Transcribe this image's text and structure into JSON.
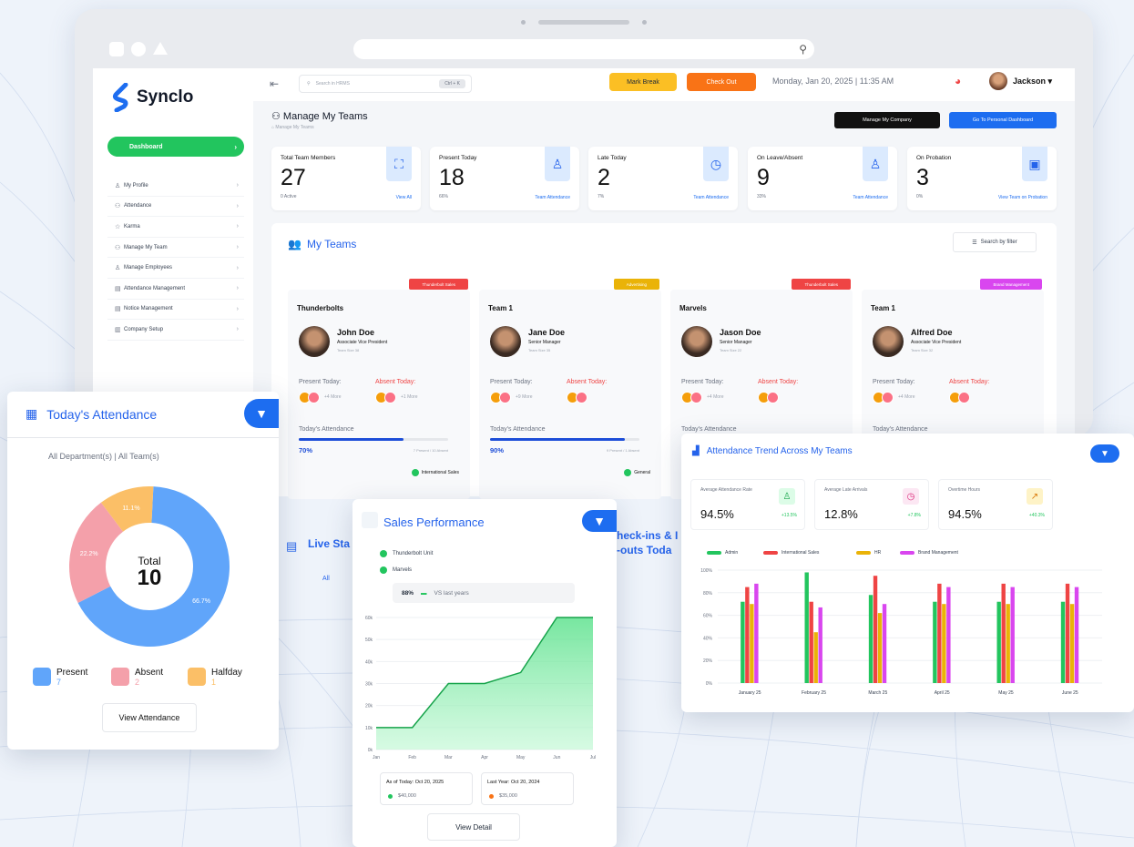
{
  "browser": {},
  "brand": {
    "name": "Synclo"
  },
  "sidebar": {
    "dashboard": "Dashboard",
    "items": [
      {
        "label": "My Profile",
        "icon": "user-icon"
      },
      {
        "label": "Attendance",
        "icon": "people-icon"
      },
      {
        "label": "Karma",
        "icon": "star-icon"
      },
      {
        "label": "Manage My Team",
        "icon": "team-icon"
      },
      {
        "label": "Manage Employees",
        "icon": "employee-icon"
      },
      {
        "label": "Attendance Management",
        "icon": "calendar-icon"
      },
      {
        "label": "Notice Management",
        "icon": "notice-icon"
      },
      {
        "label": "Company Setup",
        "icon": "building-icon"
      }
    ]
  },
  "topnav": {
    "search_placeholder": "Search in HRMS",
    "search_kbd": "Ctrl + K",
    "mark_break": "Mark Break",
    "check_out": "Check Out",
    "datetime": "Monday, Jan 20, 2025  |  11:35 AM",
    "user": "Jackson"
  },
  "page": {
    "title": "Manage My Teams",
    "breadcrumb": "Manage My Teams",
    "btn_company": "Manage My Company",
    "btn_personal": "Go To Personal Dashboard"
  },
  "stats": [
    {
      "label": "Total Team Members",
      "value": "27",
      "sub": "0 Active",
      "link": "View All",
      "icon": "team-icon"
    },
    {
      "label": "Present Today",
      "value": "18",
      "sub": "66%",
      "link": "Team Attendance",
      "icon": "user-check-icon"
    },
    {
      "label": "Late Today",
      "value": "2",
      "sub": "7%",
      "link": "Team Attendance",
      "icon": "clock-icon"
    },
    {
      "label": "On Leave/Absent",
      "value": "9",
      "sub": "33%",
      "link": "Team Attendance",
      "icon": "user-x-icon"
    },
    {
      "label": "On Probation",
      "value": "3",
      "sub": "0%",
      "link": "View Team on Probation",
      "icon": "badge-icon"
    }
  ],
  "teams": {
    "title": "My Teams",
    "search_filter": "Search by filter",
    "cards": [
      {
        "name": "Thunderbolts",
        "tag": "Thunderbolt Sales",
        "tag_color": "#ef4444",
        "person": "John Doe",
        "role": "Associate Vice President",
        "team": "Team Size 38",
        "present": "Present Today:",
        "absent": "Absent Today:",
        "present_more": "+4 More",
        "absent_more": "+1 More",
        "att_label": "Today's Attendance",
        "pct": "70%",
        "pct_value": 70,
        "counts": "7 Present / 10 Absent",
        "dept": "International Sales"
      },
      {
        "name": "Team 1",
        "tag": "Advertising",
        "tag_color": "#eab308",
        "person": "Jane Doe",
        "role": "Senior Manager",
        "team": "Team Size 35",
        "present": "Present Today:",
        "absent": "Absent Today:",
        "present_more": "+9 More",
        "absent_more": "",
        "att_label": "Today's Attendance",
        "pct": "90%",
        "pct_value": 90,
        "counts": "9 Present / 1 Absent",
        "dept": "General"
      },
      {
        "name": "Marvels",
        "tag": "Thunderbolt Sales",
        "tag_color": "#ef4444",
        "person": "Jason Doe",
        "role": "Senior Manager",
        "team": "Team Size 22",
        "present": "Present Today:",
        "absent": "Absent Today:",
        "present_more": "+4 More",
        "absent_more": "",
        "att_label": "Today's Attendance",
        "pct": "",
        "pct_value": 40,
        "counts": "",
        "dept": ""
      },
      {
        "name": "Team 1",
        "tag": "Brand Management",
        "tag_color": "#d946ef",
        "person": "Alfred Doe",
        "role": "Associate Vice President",
        "team": "Team Size 32",
        "present": "Present Today:",
        "absent": "Absent Today:",
        "present_more": "+4 More",
        "absent_more": "",
        "att_label": "Today's Attendance",
        "pct": "",
        "pct_value": 60,
        "counts": "",
        "dept": ""
      }
    ]
  },
  "attendance_card": {
    "title": "Today's Attendance",
    "filters": "All Department(s)   |   All Team(s)",
    "total_label": "Total",
    "total_value": "10",
    "slices": [
      {
        "label": "Present",
        "value": "7",
        "pct_label": "66.7%",
        "pct": 66.7,
        "color": "#60a5fa"
      },
      {
        "label": "Absent",
        "value": "2",
        "pct_label": "22.2%",
        "pct": 22.2,
        "color": "#f4a0aa"
      },
      {
        "label": "Halfday",
        "value": "1",
        "pct_label": "11.1%",
        "pct": 11.1,
        "color": "#fbbf67"
      }
    ],
    "view_btn": "View Attendance"
  },
  "sales_card": {
    "title": "Sales Performance",
    "legend": [
      "Thunderbolt Unit",
      "Marvels"
    ],
    "compare_pct": "88%",
    "compare_text": "VS last years",
    "box1_title": "As of Today: Oct 20, 2025",
    "box1_value": "$40,000",
    "box2_title": "Last Year: Oct 20, 2024",
    "box2_value": "$35,000",
    "view_btn": "View Detail"
  },
  "chart_data": [
    {
      "type": "area",
      "x": [
        "Jan",
        "Feb",
        "Mar",
        "Apr",
        "May",
        "Jun",
        "Jul"
      ],
      "series": [
        {
          "name": "Thunderbolt Unit",
          "values": [
            10,
            10,
            30,
            30,
            35,
            60,
            60
          ]
        }
      ],
      "yticks": [
        "0k",
        "10k",
        "20k",
        "30k",
        "40k",
        "50k",
        "60k"
      ],
      "ylim": [
        0,
        60
      ]
    },
    {
      "type": "bar",
      "title": "Attendance Trend Across My Teams",
      "categories": [
        "January 25",
        "February 25",
        "March 25",
        "April 25",
        "May 25",
        "June 25"
      ],
      "series": [
        {
          "name": "Admin",
          "color": "#22c55e",
          "values": [
            72,
            98,
            78,
            72,
            72,
            72
          ]
        },
        {
          "name": "International Sales",
          "color": "#ef4444",
          "values": [
            85,
            72,
            95,
            88,
            88,
            88
          ]
        },
        {
          "name": "HR",
          "color": "#eab308",
          "values": [
            70,
            45,
            62,
            70,
            70,
            70
          ]
        },
        {
          "name": "Brand Management",
          "color": "#d946ef",
          "values": [
            88,
            67,
            70,
            85,
            85,
            85
          ]
        }
      ],
      "yticks": [
        "0%",
        "20%",
        "40%",
        "60%",
        "80%",
        "100%"
      ],
      "ylim": [
        0,
        100
      ]
    }
  ],
  "trend_card": {
    "metrics": [
      {
        "label": "Average Attendance Rate",
        "value": "94.5%",
        "change": "+13.5%",
        "icon": "user-icon",
        "bg": "#dcfce7",
        "fg": "#16a34a"
      },
      {
        "label": "Average Late Arrivals",
        "value": "12.8%",
        "change": "+7.8%",
        "icon": "clock-icon",
        "bg": "#fce7f3",
        "fg": "#db2777"
      },
      {
        "label": "Overtime Hours",
        "value": "94.5%",
        "change": "+40.3%",
        "icon": "trend-icon",
        "bg": "#fef3c7",
        "fg": "#d97706"
      }
    ]
  },
  "live": {
    "title": "Live Sta",
    "all": "All"
  },
  "checkins": {
    "l1": "heck-ins & I",
    "l2": "-outs Toda"
  }
}
